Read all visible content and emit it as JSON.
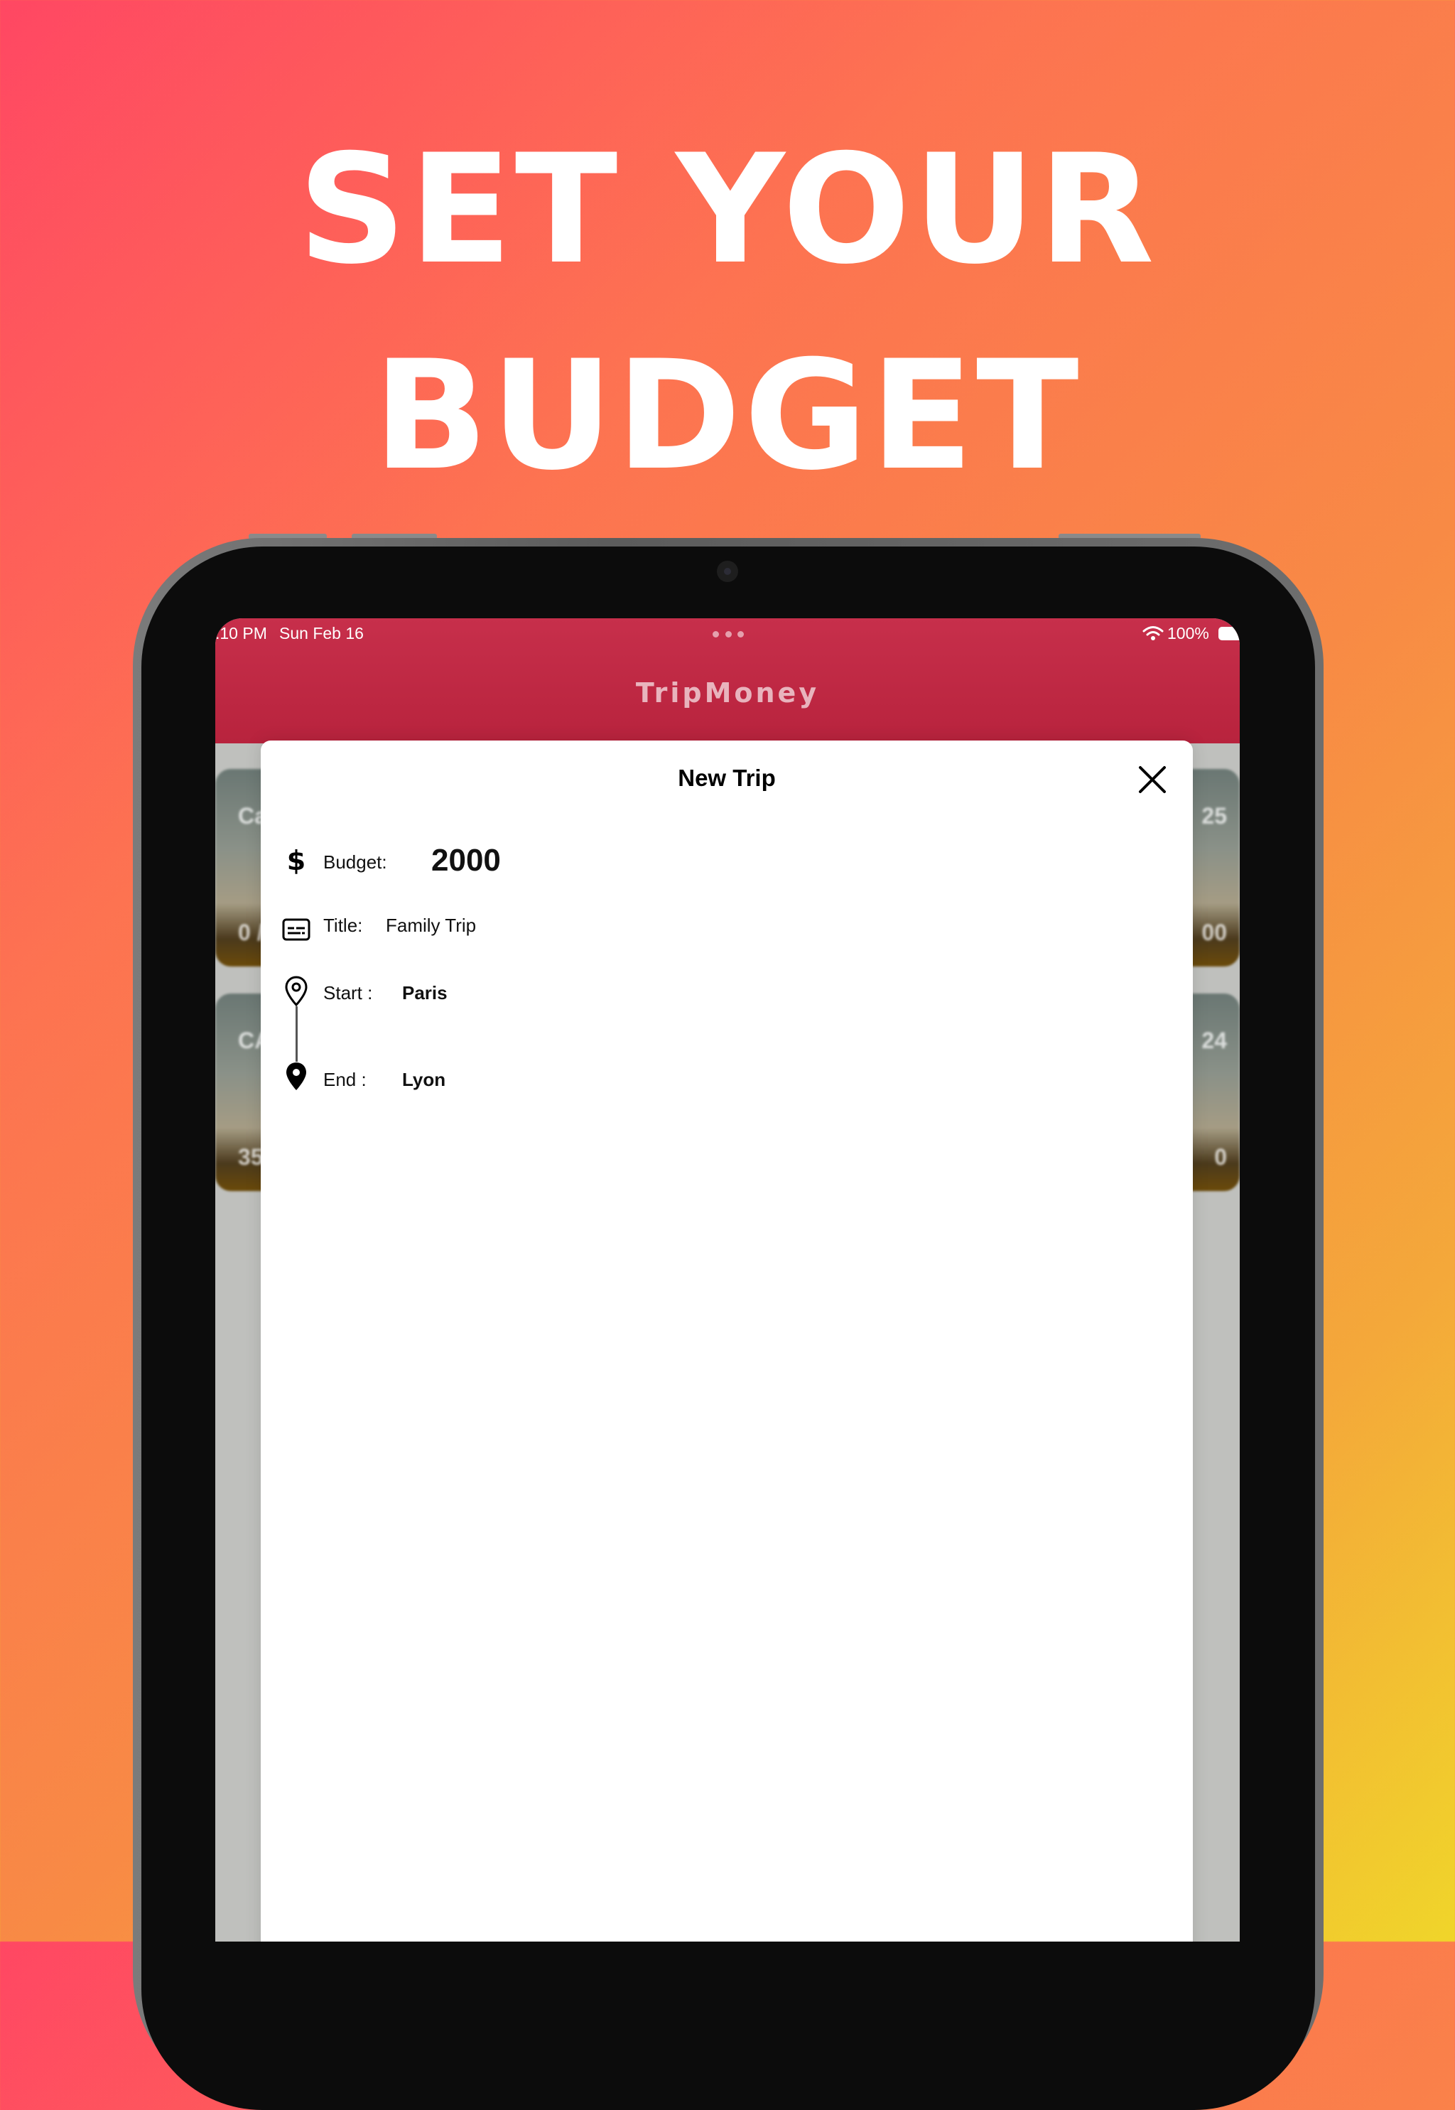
{
  "headline": {
    "line1": "SET YOUR",
    "line2": "BUDGET"
  },
  "status_bar": {
    "time": ":10 PM",
    "date": "Sun Feb 16",
    "battery": "100%"
  },
  "app": {
    "title": "TripMoney"
  },
  "background_cards": [
    {
      "left_top": "Ca",
      "right_top": "25",
      "left_bottom": "0 /",
      "right_bottom": "00"
    },
    {
      "left_top": "CA",
      "right_top": "24",
      "left_bottom": "35",
      "right_bottom": "0"
    }
  ],
  "modal": {
    "title": "New Trip",
    "budget": {
      "label": "Budget:",
      "value": "2000"
    },
    "trip_title": {
      "label": "Title:",
      "value": "Family Trip"
    },
    "start": {
      "label": "Start :",
      "value": "Paris"
    },
    "end": {
      "label": "End :",
      "value": "Lyon"
    }
  },
  "icons": {
    "budget": "dollar-icon",
    "title": "subtitles-icon",
    "start": "map-pin-outline-icon",
    "end": "map-pin-filled-icon",
    "close": "close-icon",
    "wifi": "wifi-icon",
    "battery": "battery-icon"
  },
  "colors": {
    "header": "#c72f4b",
    "gradient_start": "#ff4763",
    "gradient_end": "#f0d52a"
  }
}
